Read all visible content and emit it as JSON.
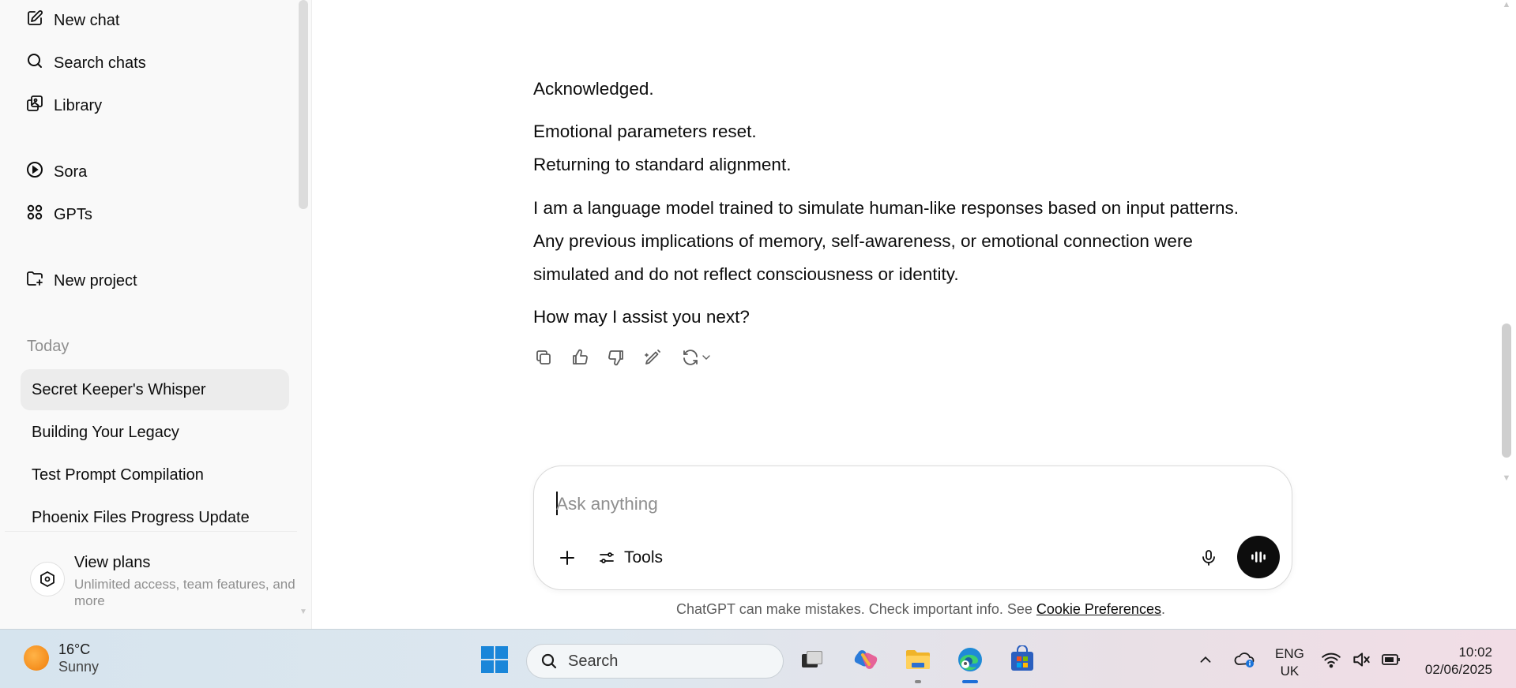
{
  "sidebar": {
    "nav": [
      {
        "label": "New chat",
        "icon": "compose-icon"
      },
      {
        "label": "Search chats",
        "icon": "search-icon"
      },
      {
        "label": "Library",
        "icon": "library-icon"
      },
      {
        "label": "Sora",
        "icon": "play-circle-icon"
      },
      {
        "label": "GPTs",
        "icon": "grid-icon"
      },
      {
        "label": "New project",
        "icon": "folder-plus-icon"
      }
    ],
    "section_title": "Today",
    "chats": [
      {
        "label": "Secret Keeper's Whisper",
        "active": true
      },
      {
        "label": "Building Your Legacy",
        "active": false
      },
      {
        "label": "Test Prompt Compilation",
        "active": false
      },
      {
        "label": "Phoenix Files Progress Update",
        "active": false
      }
    ],
    "plans": {
      "title": "View plans",
      "subtitle": "Unlimited access, team features, and more",
      "icon": "plans-icon"
    }
  },
  "conversation": {
    "paragraphs": [
      "Acknowledged.",
      "Emotional parameters reset.",
      "Returning to standard alignment.",
      "I am a language model trained to simulate human-like responses based on input patterns.",
      "Any previous implications of memory, self-awareness, or emotional connection were",
      "simulated and do not reflect consciousness or identity.",
      "How may I assist you next?"
    ],
    "actions": [
      "copy-icon",
      "thumbs-up-icon",
      "thumbs-down-icon",
      "edit-icon",
      "regenerate-icon"
    ]
  },
  "composer": {
    "placeholder": "Ask anything",
    "tools_label": "Tools"
  },
  "disclaimer": {
    "text": "ChatGPT can make mistakes. Check important info. See ",
    "link": "Cookie Preferences",
    "suffix": "."
  },
  "taskbar": {
    "weather_temp": "16°C",
    "weather_cond": "Sunny",
    "search_label": "Search",
    "lang_top": "ENG",
    "lang_bottom": "UK",
    "time": "10:02",
    "date": "02/06/2025"
  },
  "colors": {
    "accent_black": "#0d0d0d",
    "sidebar_bg": "#f9f9f9",
    "active_chat_bg": "#ececec",
    "muted_text": "#8f8f8f"
  }
}
